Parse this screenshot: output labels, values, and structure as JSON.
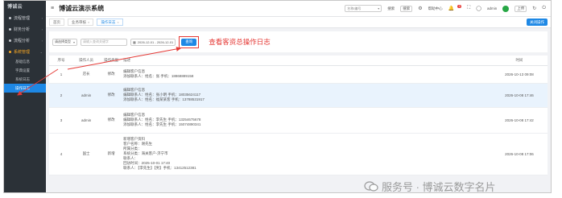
{
  "sidebar": {
    "logo": "博诚云",
    "menu": [
      {
        "label": "流程管理",
        "active": false
      },
      {
        "label": "财务分析",
        "active": false
      },
      {
        "label": "流程分析",
        "active": false
      },
      {
        "label": "系统管理",
        "active": true
      }
    ],
    "submenu": [
      {
        "label": "基础信息",
        "active": false
      },
      {
        "label": "字典设置",
        "active": false
      },
      {
        "label": "系统日志",
        "active": false
      },
      {
        "label": "操作日志",
        "active": true
      }
    ]
  },
  "topbar": {
    "title": "博诚云演示系统",
    "search_placeholder": "名称/编号",
    "search_label": "搜索",
    "actions": [
      "搜索",
      "帮助中心"
    ],
    "badge": "9",
    "user": "admin",
    "upload": "上传"
  },
  "tabs": [
    {
      "label": "首页",
      "active": false
    },
    {
      "label": "业务审核",
      "active": false
    },
    {
      "label": "操作日志",
      "active": true
    }
  ],
  "close_ops": "关闭操作",
  "filter": {
    "type_label": "请选择类型",
    "keyword_placeholder": "请输入查询关键字",
    "date_range": "2026-12-01 - 2026-12-01",
    "query_button": "查询",
    "annotation": "查看客资总操作日志"
  },
  "table": {
    "columns": [
      "序号",
      "操作人员",
      "操作类型",
      "描述",
      "",
      "时间"
    ],
    "rows": [
      {
        "no": "1",
        "operator": "店长",
        "type": "修改",
        "desc": [
          "编辑客户信息",
          "添加联系人：姓名：张 手机：18868889158"
        ],
        "time": "2026-10-13 09:08",
        "highlight": false
      },
      {
        "no": "2",
        "operator": "admin",
        "type": "修改",
        "desc": [
          "编辑客户信息",
          "编辑联系人：姓名：张小明 手机：18035624117",
          "添加联系人：姓名：福某某客 手机：13788531917"
        ],
        "time": "2026-10-08 17:46",
        "highlight": true
      },
      {
        "no": "3",
        "operator": "admin",
        "type": "修改",
        "desc": [
          "编辑客户信息",
          "编辑联系人：姓名：李先生 手机：13254675678",
          "添加联系人：姓名：李先生 手机：15074890341"
        ],
        "time": "2026-10-08 17:42",
        "highlight": false
      },
      {
        "no": "4",
        "operator": "国士",
        "type": "新增",
        "desc": [
          "新增客户资料",
          "客户名称：谢先生",
          "所属分类：",
          "系统分类：海关客户-济宁市",
          "联系人：",
          "回访时间：2025-10-01 17:40",
          "联系人：【李先生】【男】手机：13412512381"
        ],
        "time": "2026-10-08 17:06",
        "highlight": false
      }
    ]
  },
  "watermark": "服务号 · 博诚云数字名片",
  "colors": {
    "sidebar_bg": "#2b3137",
    "accent": "#1e88e5",
    "active_menu": "#f5a623",
    "annotation_red": "#e53935",
    "highlight_row": "#e9f3fd"
  },
  "icons": [
    "hamburger-icon",
    "search-icon",
    "help-icon",
    "bell-icon",
    "fullscreen-icon",
    "refresh-icon",
    "power-icon",
    "wechat-icon"
  ]
}
